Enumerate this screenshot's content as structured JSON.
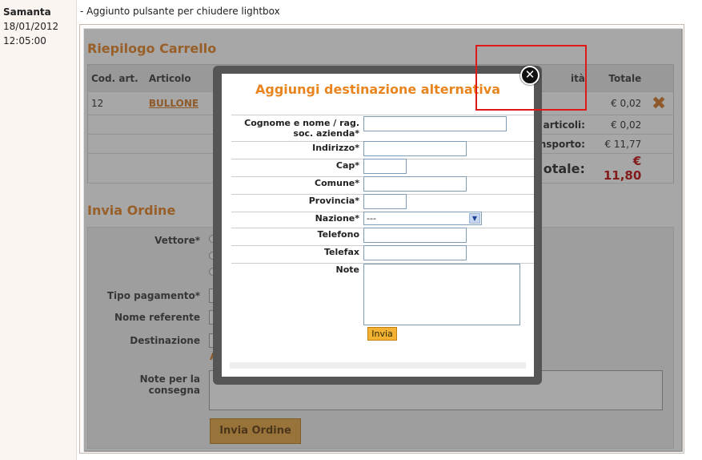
{
  "entry": {
    "author": "Samanta",
    "date": "18/01/2012",
    "time": "12:05:00",
    "note": "- Aggiunto pulsante per chiudere lightbox"
  },
  "cart": {
    "title": "Riepilogo Carrello",
    "columns": [
      "Cod. art.",
      "Articolo",
      "ità",
      "Totale"
    ],
    "row": {
      "code": "12",
      "name": "BULLONE",
      "total": "€ 0,02"
    },
    "articles_label": "articoli:",
    "articles_value": "€ 0,02",
    "shipping_label": "nsporto:",
    "shipping_value": "€ 11,77",
    "total_label": "otale:",
    "total_value": "€ 11,80"
  },
  "order": {
    "title": "Invia Ordine",
    "vettore": "Vettore*",
    "tipo_pagamento": "Tipo pagamento*",
    "nome_referente": "Nome referente",
    "destinazione": "Destinazione",
    "destinazione_link": "A",
    "note_label": "Note per la consegna",
    "submit": "Invia Ordine"
  },
  "lightbox": {
    "title": "Aggiungi destinazione alternativa",
    "cognome": "Cognome e nome / rag. soc. azienda*",
    "indirizzo": "Indirizzo*",
    "cap": "Cap*",
    "comune": "Comune*",
    "provincia": "Provincia*",
    "nazione": "Nazione*",
    "nazione_value": "---",
    "telefono": "Telefono",
    "telefax": "Telefax",
    "note": "Note",
    "submit": "Invia",
    "close_icon": "close-icon"
  },
  "colors": {
    "accent": "#e37d1b",
    "total_red": "#c00000",
    "highlight": "#e01818"
  }
}
